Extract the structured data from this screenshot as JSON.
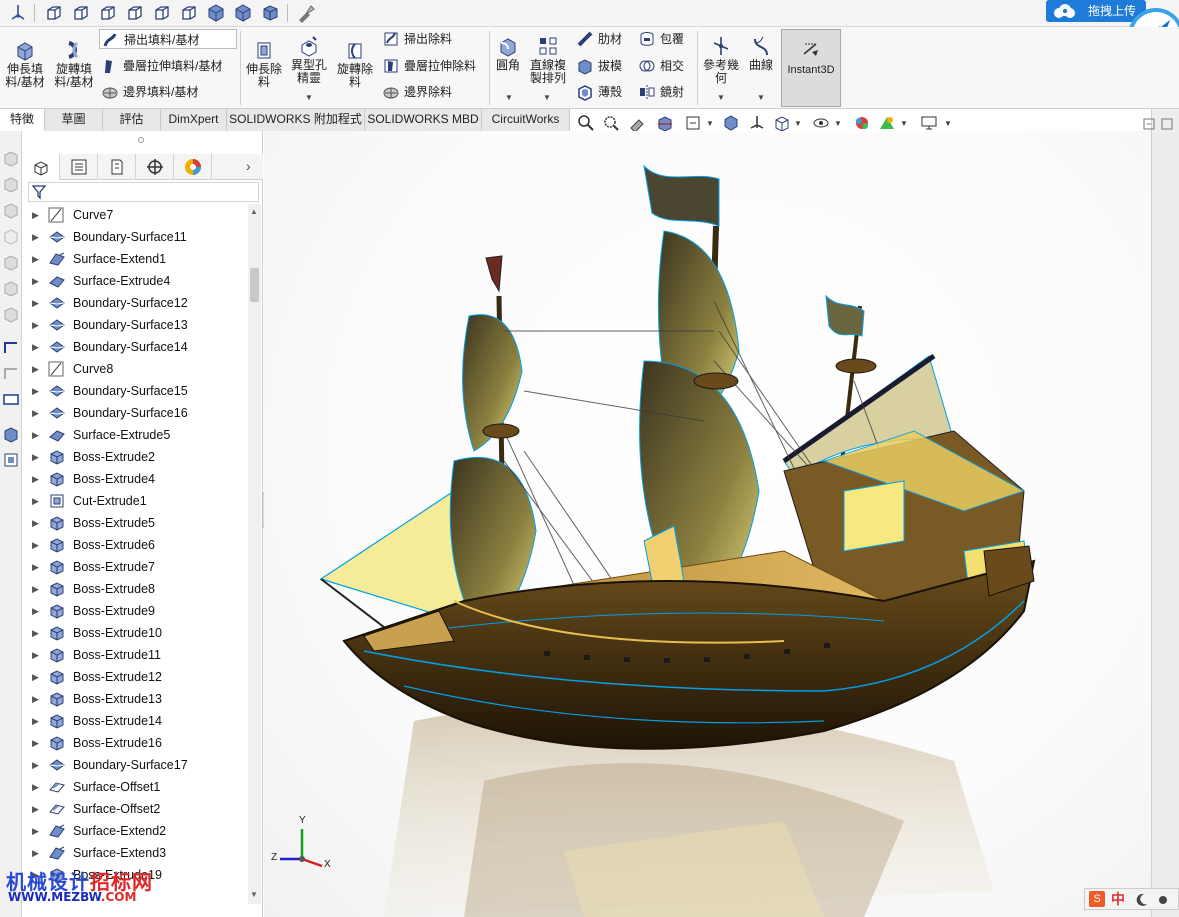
{
  "upload_button": {
    "label": "拖拽上传"
  },
  "ribbon": {
    "extrude_boss": "伸長填\n料/基材",
    "revolve_boss": "旋轉填\n料/基材",
    "swept_boss": "掃出填料/基材",
    "lofted_boss": "疊層拉伸填料/基材",
    "boundary_boss": "邊界填料/基材",
    "extrude_cut": "伸長除\n料",
    "hole_wizard": "異型孔\n精靈",
    "revolve_cut": "旋轉除\n料",
    "swept_cut": "掃出除料",
    "lofted_cut": "疊層拉伸除料",
    "boundary_cut": "邊界除料",
    "fillet": "圓角",
    "linear_pattern": "直線複\n製排列",
    "rib": "肋材",
    "draft": "拔模",
    "shell": "薄殼",
    "wrap": "包覆",
    "intersect": "相交",
    "mirror": "鏡射",
    "reference_geometry": "參考幾\n何",
    "curves": "曲線",
    "instant3d": "Instant3D"
  },
  "tabs": [
    "特徵",
    "草圖",
    "評估",
    "DimXpert",
    "SOLIDWORKS 附加程式",
    "SOLIDWORKS MBD",
    "CircuitWorks"
  ],
  "active_tab": "特徵",
  "feature_tree": [
    {
      "label": "Curve7",
      "icon": "curve-icon"
    },
    {
      "label": "Boundary-Surface11",
      "icon": "boundary-surface-icon"
    },
    {
      "label": "Surface-Extend1",
      "icon": "surface-extend-icon"
    },
    {
      "label": "Surface-Extrude4",
      "icon": "surface-extrude-icon"
    },
    {
      "label": "Boundary-Surface12",
      "icon": "boundary-surface-icon"
    },
    {
      "label": "Boundary-Surface13",
      "icon": "boundary-surface-icon"
    },
    {
      "label": "Boundary-Surface14",
      "icon": "boundary-surface-icon"
    },
    {
      "label": "Curve8",
      "icon": "curve-icon"
    },
    {
      "label": "Boundary-Surface15",
      "icon": "boundary-surface-icon"
    },
    {
      "label": "Boundary-Surface16",
      "icon": "boundary-surface-icon"
    },
    {
      "label": "Surface-Extrude5",
      "icon": "surface-extrude-icon"
    },
    {
      "label": "Boss-Extrude2",
      "icon": "boss-extrude-icon"
    },
    {
      "label": "Boss-Extrude4",
      "icon": "boss-extrude-icon"
    },
    {
      "label": "Cut-Extrude1",
      "icon": "cut-extrude-icon"
    },
    {
      "label": "Boss-Extrude5",
      "icon": "boss-extrude-icon"
    },
    {
      "label": "Boss-Extrude6",
      "icon": "boss-extrude-icon"
    },
    {
      "label": "Boss-Extrude7",
      "icon": "boss-extrude-icon"
    },
    {
      "label": "Boss-Extrude8",
      "icon": "boss-extrude-icon"
    },
    {
      "label": "Boss-Extrude9",
      "icon": "boss-extrude-icon"
    },
    {
      "label": "Boss-Extrude10",
      "icon": "boss-extrude-icon"
    },
    {
      "label": "Boss-Extrude11",
      "icon": "boss-extrude-icon"
    },
    {
      "label": "Boss-Extrude12",
      "icon": "boss-extrude-icon"
    },
    {
      "label": "Boss-Extrude13",
      "icon": "boss-extrude-icon"
    },
    {
      "label": "Boss-Extrude14",
      "icon": "boss-extrude-icon"
    },
    {
      "label": "Boss-Extrude16",
      "icon": "boss-extrude-icon"
    },
    {
      "label": "Boundary-Surface17",
      "icon": "boundary-surface-icon"
    },
    {
      "label": "Surface-Offset1",
      "icon": "surface-offset-icon"
    },
    {
      "label": "Surface-Offset2",
      "icon": "surface-offset-icon"
    },
    {
      "label": "Surface-Extend2",
      "icon": "surface-extend-icon"
    },
    {
      "label": "Surface-Extend3",
      "icon": "surface-extend-icon"
    },
    {
      "label": "Boss-Extrude19",
      "icon": "boss-extrude-icon"
    }
  ],
  "triad": {
    "x": "X",
    "y": "Y",
    "z": "Z"
  },
  "watermark": {
    "cn_a": "机械设计",
    "cn_b": "招标网",
    "url_a": "WWW.MEZBW",
    "url_b": ".COM"
  },
  "ime": {
    "z": "中",
    "s": "S"
  },
  "colors": {
    "accent": "#1e7bd8",
    "sail": "#5a5230",
    "hull": "#3a2a12",
    "edge": "#00a0e8"
  }
}
